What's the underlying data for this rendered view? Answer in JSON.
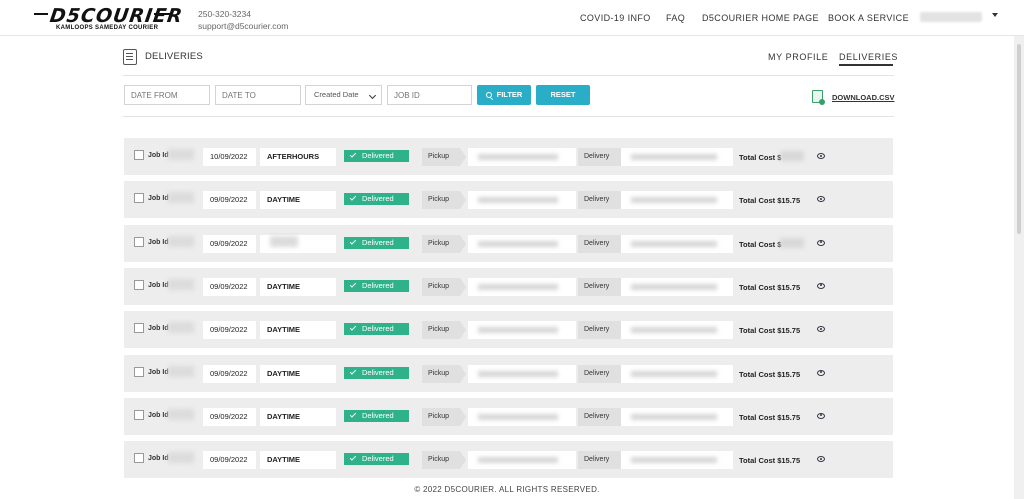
{
  "brand": {
    "logo_text": "D5COURIER",
    "tagline": "KAMLOOPS SAMEDAY COURIER"
  },
  "contact": {
    "phone": "250-320-3234",
    "email": "support@d5courier.com"
  },
  "nav": {
    "covid": "COVID-19 INFO",
    "faq": "FAQ",
    "home": "D5COURIER HOME PAGE",
    "book": "BOOK A SERVICE"
  },
  "page": {
    "title": "DELIVERIES"
  },
  "tabs": {
    "profile": "MY PROFILE",
    "deliveries": "DELIVERIES"
  },
  "filters": {
    "date_from": "DATE FROM",
    "date_to": "DATE TO",
    "sort": "Created Date",
    "job_id": "JOB ID",
    "filter_btn": "FILTER",
    "reset_btn": "RESET",
    "download": "DOWNLOAD.CSV"
  },
  "labels": {
    "job": "Job Id",
    "pickup": "Pickup",
    "delivery": "Delivery",
    "status": "Delivered",
    "total": "Total Cost $"
  },
  "rows": [
    {
      "date": "10/09/2022",
      "type": "AFTERHOURS",
      "cost": ""
    },
    {
      "date": "09/09/2022",
      "type": "DAYTIME",
      "cost": "15.75"
    },
    {
      "date": "09/09/2022",
      "type": "",
      "cost": ""
    },
    {
      "date": "09/09/2022",
      "type": "DAYTIME",
      "cost": "15.75"
    },
    {
      "date": "09/09/2022",
      "type": "DAYTIME",
      "cost": "15.75"
    },
    {
      "date": "09/09/2022",
      "type": "DAYTIME",
      "cost": "15.75"
    },
    {
      "date": "09/09/2022",
      "type": "DAYTIME",
      "cost": "15.75"
    },
    {
      "date": "09/09/2022",
      "type": "DAYTIME",
      "cost": "15.75"
    }
  ],
  "footer": {
    "text": "© 2022 D5COURIER. ALL RIGHTS RESERVED."
  },
  "colors": {
    "accent": "#2aaec8",
    "delivered": "#2fb28a"
  }
}
